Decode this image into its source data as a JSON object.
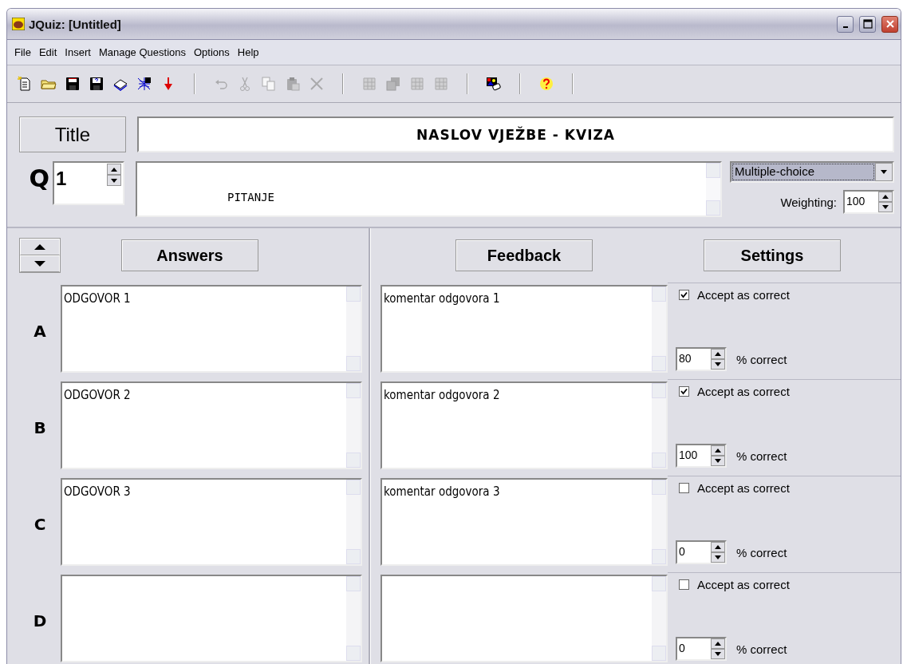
{
  "window": {
    "title": "JQuiz: [Untitled]"
  },
  "menu": [
    "File",
    "Edit",
    "Insert",
    "Manage Questions",
    "Options",
    "Help"
  ],
  "toolbar": [
    [
      {
        "kind": "new",
        "disabled": false
      },
      {
        "kind": "open",
        "disabled": false
      },
      {
        "kind": "save",
        "disabled": false
      },
      {
        "kind": "saveas",
        "disabled": false
      },
      {
        "kind": "book",
        "disabled": false
      },
      {
        "kind": "web",
        "disabled": false
      },
      {
        "kind": "export",
        "disabled": false
      }
    ],
    [
      {
        "kind": "undo",
        "disabled": true
      },
      {
        "kind": "cut",
        "disabled": true
      },
      {
        "kind": "copy",
        "disabled": true
      },
      {
        "kind": "paste",
        "disabled": true
      },
      {
        "kind": "delete",
        "disabled": true
      }
    ],
    [
      {
        "kind": "tool",
        "disabled": true
      },
      {
        "kind": "pages",
        "disabled": true
      },
      {
        "kind": "tool",
        "disabled": true
      },
      {
        "kind": "tool",
        "disabled": true
      }
    ],
    [
      {
        "kind": "image",
        "disabled": false
      }
    ],
    [
      {
        "kind": "help",
        "disabled": false
      }
    ]
  ],
  "title_button": "Title",
  "title_value": "NASLOV  VJEŽBE  -  KVIZA",
  "question": {
    "label": "Q",
    "number": "1",
    "text": "PITANJE",
    "type": "Multiple-choice",
    "weighting_label": "Weighting:",
    "weighting": "100"
  },
  "headers": {
    "answers": "Answers",
    "feedback": "Feedback",
    "settings": "Settings"
  },
  "answers": [
    {
      "letter": "A",
      "answer": "ODGOVOR 1",
      "feedback": "komentar odgovora 1",
      "accept_label": "Accept as correct",
      "accepted": true,
      "percent": "80",
      "percent_label": "% correct"
    },
    {
      "letter": "B",
      "answer": "ODGOVOR 2",
      "feedback": "komentar odgovora 2",
      "accept_label": "Accept as correct",
      "accepted": true,
      "percent": "100",
      "percent_label": "% correct"
    },
    {
      "letter": "C",
      "answer": "ODGOVOR 3",
      "feedback": "komentar odgovora 3",
      "accept_label": "Accept as correct",
      "accepted": false,
      "percent": "0",
      "percent_label": "% correct"
    },
    {
      "letter": "D",
      "accept_label": "Accept as correct",
      "accepted": false,
      "percent": "0",
      "percent_label": "% correct"
    }
  ]
}
